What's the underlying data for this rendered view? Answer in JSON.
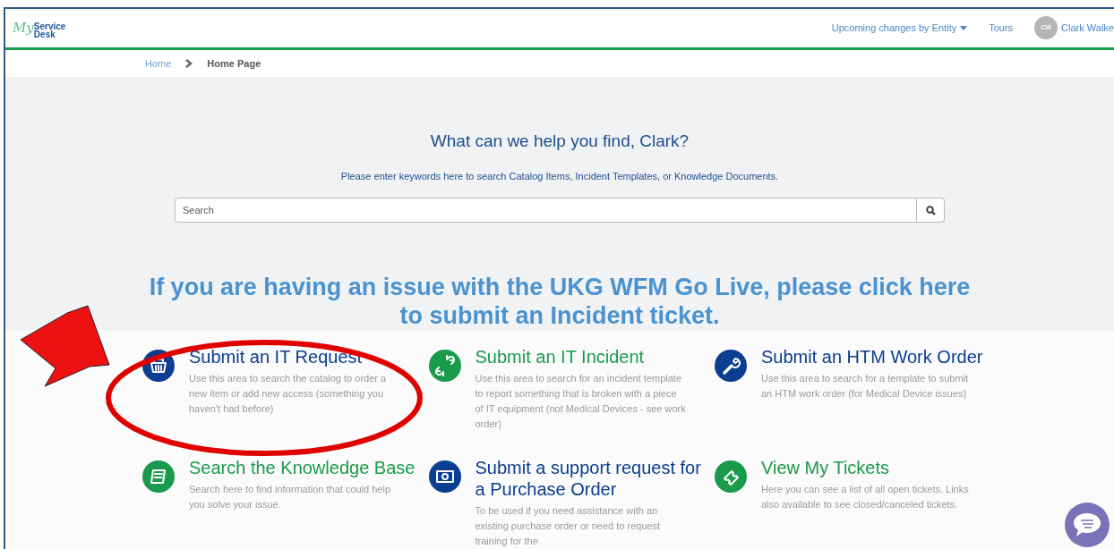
{
  "header": {
    "logo_script": "My",
    "logo_word1": "Service",
    "logo_word2": "Desk",
    "nav": [
      {
        "label": "Upcoming changes by Entity",
        "kind": "dropdown"
      },
      {
        "label": "Tours",
        "kind": "link"
      }
    ],
    "user": {
      "initials": "CW",
      "name": "Clark Walke"
    }
  },
  "breadcrumb": [
    {
      "label": "Home",
      "selected": false
    },
    {
      "label": "Home Page",
      "selected": true
    }
  ],
  "hero": {
    "heading": "What can we help you find, Clark?",
    "subheading": "Please enter keywords here to search Catalog Items, Incident Templates, or Knowledge Documents.",
    "search": {
      "placeholder": "Search"
    },
    "banner": "If you are having an issue with the UKG WFM Go Live, please click here to submit an Incident ticket."
  },
  "cards": [
    {
      "kind": "basket",
      "color": "#0b3d91",
      "title": "Submit an IT Request",
      "description": "Use this area to search the catalog to order a new item or add new access (something you haven't had before)"
    },
    {
      "kind": "broken-link",
      "color": "#1a9a4b",
      "title": "Submit an IT Incident",
      "description": "Use this area to search for an incident template to report something that is broken with a piece of IT equipment (not Medical Devices - see work order)"
    },
    {
      "kind": "wrench",
      "color": "#0b3d91",
      "title": "Submit an HTM Work Order",
      "description": "Use this area to search for a template to submit an HTM work order (for Medical Device issues)"
    },
    {
      "kind": "book",
      "color": "#1a9a4b",
      "title": "Search the Knowledge Base",
      "description": "Search here to find information that could help you solve your issue."
    },
    {
      "kind": "money",
      "color": "#0b3d91",
      "title": "Submit a support request for a Purchase Order",
      "description": "To be used if you need assistance with an existing purchase order or need to request training for the"
    },
    {
      "kind": "ticket",
      "color": "#1a9a4b",
      "title": "View My Tickets",
      "description": "Here you can see a list of all open tickets. Links also available to see closed/canceled tickets."
    }
  ]
}
